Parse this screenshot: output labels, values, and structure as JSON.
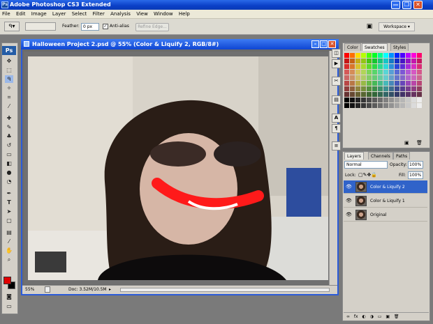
{
  "app": {
    "title": "Adobe Photoshop CS3 Extended",
    "logo": "Ps"
  },
  "window_controls": {
    "minimize": "—",
    "restore": "❐",
    "close": "✕"
  },
  "menu": [
    "File",
    "Edit",
    "Image",
    "Layer",
    "Select",
    "Filter",
    "Analysis",
    "View",
    "Window",
    "Help"
  ],
  "options": {
    "feather_label": "Feather:",
    "feather_value": "0 px",
    "anti_alias_label": "Anti-alias",
    "refine_edge": "Refine Edge...",
    "workspace": "Workspace ▾"
  },
  "document": {
    "title": "Halloween Project 2.psd @ 55% (Color & Liquify 2, RGB/8#)",
    "zoom": "55%",
    "doc_info": "Doc: 3.52M/10.5M"
  },
  "colors": {
    "foreground": "#e00000",
    "background": "#000000",
    "accent": "#2b5bd8"
  },
  "swatches_panel": {
    "tabs": [
      "Color",
      "Swatches",
      "Styles"
    ],
    "active_tab": "Swatches"
  },
  "layers_panel": {
    "tabs": [
      "Layers",
      "Channels",
      "Paths"
    ],
    "active_tab": "Layers",
    "blend_mode": "Normal",
    "opacity_label": "Opacity:",
    "opacity_value": "100%",
    "lock_label": "Lock:",
    "fill_label": "Fill:",
    "fill_value": "100%",
    "layers": [
      {
        "name": "Color & Liquify 2",
        "selected": true
      },
      {
        "name": "Color & Liquify 1",
        "selected": false
      },
      {
        "name": "Original",
        "selected": false
      }
    ]
  }
}
